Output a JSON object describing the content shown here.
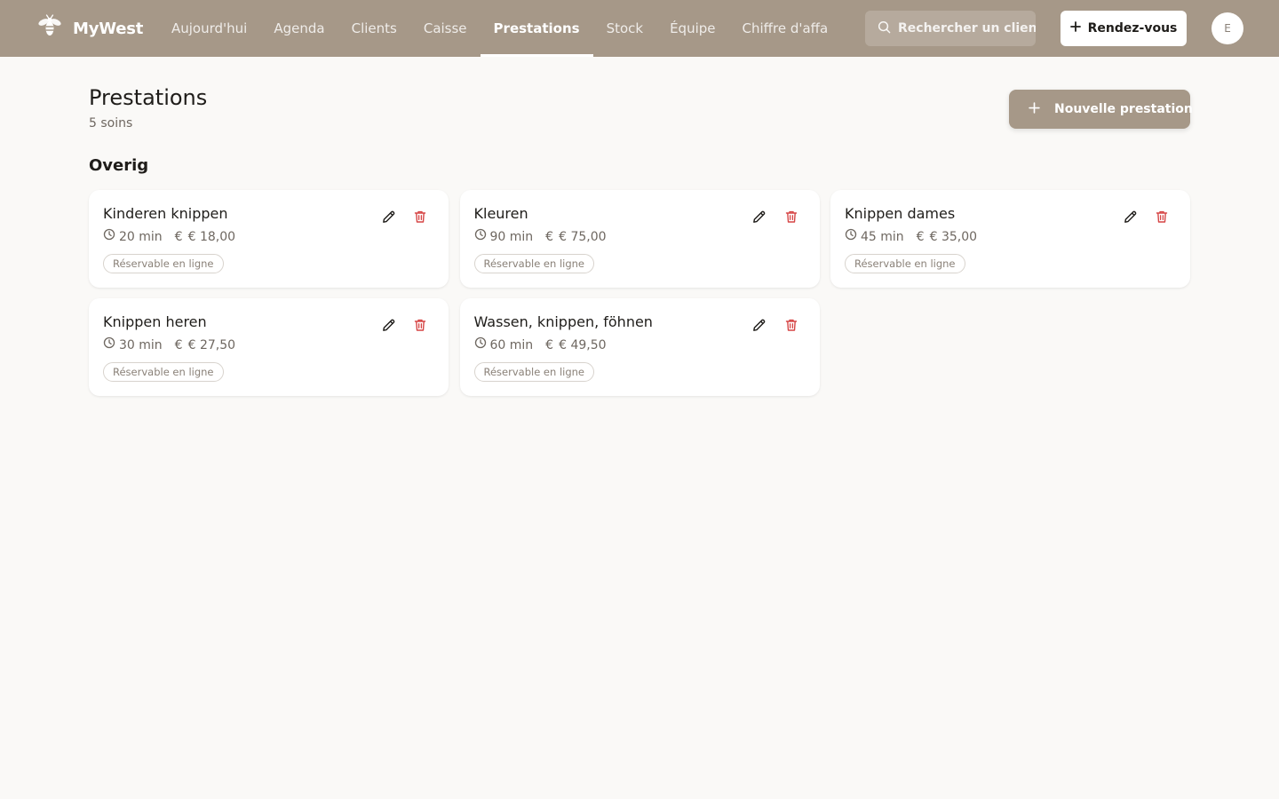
{
  "app": {
    "name": "MyWest",
    "logo_icon": "bee-icon"
  },
  "nav": {
    "items": [
      {
        "label": "Aujourd'hui",
        "active": false
      },
      {
        "label": "Agenda",
        "active": false
      },
      {
        "label": "Clients",
        "active": false
      },
      {
        "label": "Caisse",
        "active": false
      },
      {
        "label": "Prestations",
        "active": true
      },
      {
        "label": "Stock",
        "active": false
      },
      {
        "label": "Équipe",
        "active": false
      },
      {
        "label": "Chiffre d'affaires",
        "active": false
      }
    ]
  },
  "search": {
    "placeholder": "Rechercher un client",
    "icon": "search-icon"
  },
  "rdv_button": {
    "label": "Rendez-vous",
    "icon": "plus-icon"
  },
  "avatar": {
    "initial": "E"
  },
  "page": {
    "title": "Prestations",
    "subtitle": "5 soins",
    "new_button": "Nouvelle prestation"
  },
  "section": {
    "title": "Overig"
  },
  "services": [
    {
      "name": "Kinderen knippen",
      "duration": "20 min",
      "price": "€ 18,00",
      "badge": "Réservable en ligne"
    },
    {
      "name": "Kleuren",
      "duration": "90 min",
      "price": "€ 75,00",
      "badge": "Réservable en ligne"
    },
    {
      "name": "Knippen dames",
      "duration": "45 min",
      "price": "€ 35,00",
      "badge": "Réservable en ligne"
    },
    {
      "name": "Knippen heren",
      "duration": "30 min",
      "price": "€ 27,50",
      "badge": "Réservable en ligne"
    },
    {
      "name": "Wassen, knippen, föhnen",
      "duration": "60 min",
      "price": "€ 49,50",
      "badge": "Réservable en ligne"
    }
  ],
  "colors": {
    "header_bg": "#a69888",
    "page_bg": "#faf9f7",
    "delete": "#d64545"
  },
  "icons": {
    "edit": "pencil-icon",
    "delete": "trash-icon",
    "duration": "clock-icon",
    "price": "euro-icon"
  }
}
